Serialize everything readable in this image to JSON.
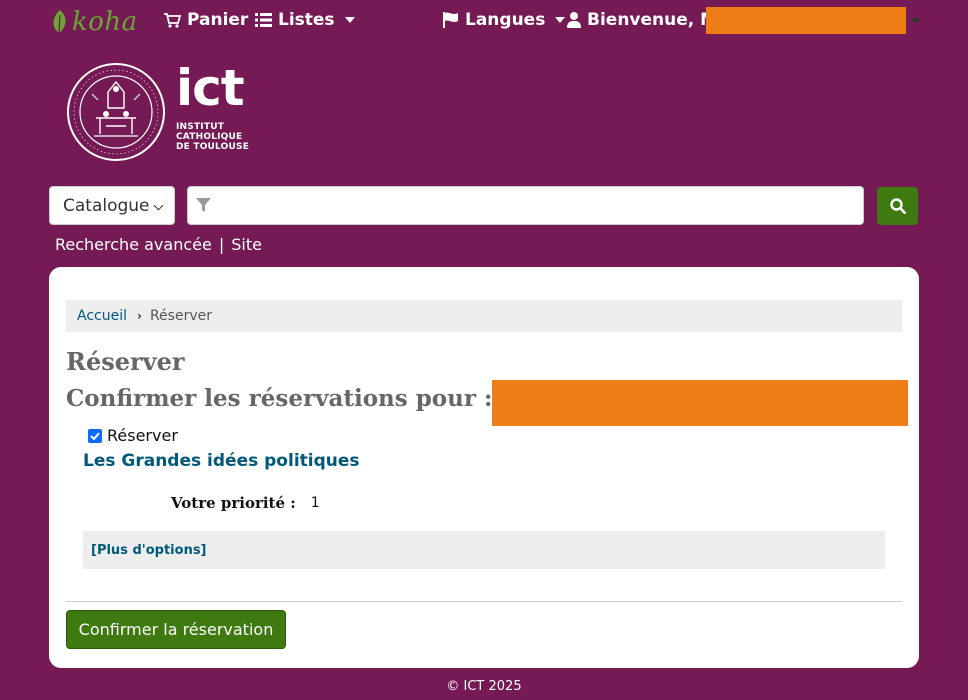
{
  "nav": {
    "logo_text": "koha",
    "cart_label": "Panier",
    "lists_label": "Listes",
    "languages_label": "Langues",
    "welcome_label": "Bienvenue, M."
  },
  "brand": {
    "name": "ict",
    "line1": "INSTITUT",
    "line2": "CATHOLIQUE",
    "line3": "DE TOULOUSE"
  },
  "search": {
    "scope_selected": "Catalogue",
    "query_value": "",
    "advanced_label": "Recherche avancée",
    "separator": "|",
    "site_label": "Site"
  },
  "breadcrumb": {
    "home": "Accueil",
    "current": "Réserver"
  },
  "main": {
    "title": "Réserver",
    "subtitle": "Confirmer les réservations pour : M.",
    "hold_checkbox_label": "Réserver",
    "hold_checked": true,
    "book_title": "Les Grandes idées politiques",
    "priority_label": "Votre priorité :",
    "priority_value": "1",
    "more_options": "[Plus d'options]",
    "confirm_button": "Confirmer la réservation"
  },
  "footer": {
    "copyright": "© ICT 2025"
  },
  "colors": {
    "background": "#751a55",
    "button_green": "#3f7a10",
    "link_blue": "#00587a",
    "redaction": "#ef7d15"
  }
}
